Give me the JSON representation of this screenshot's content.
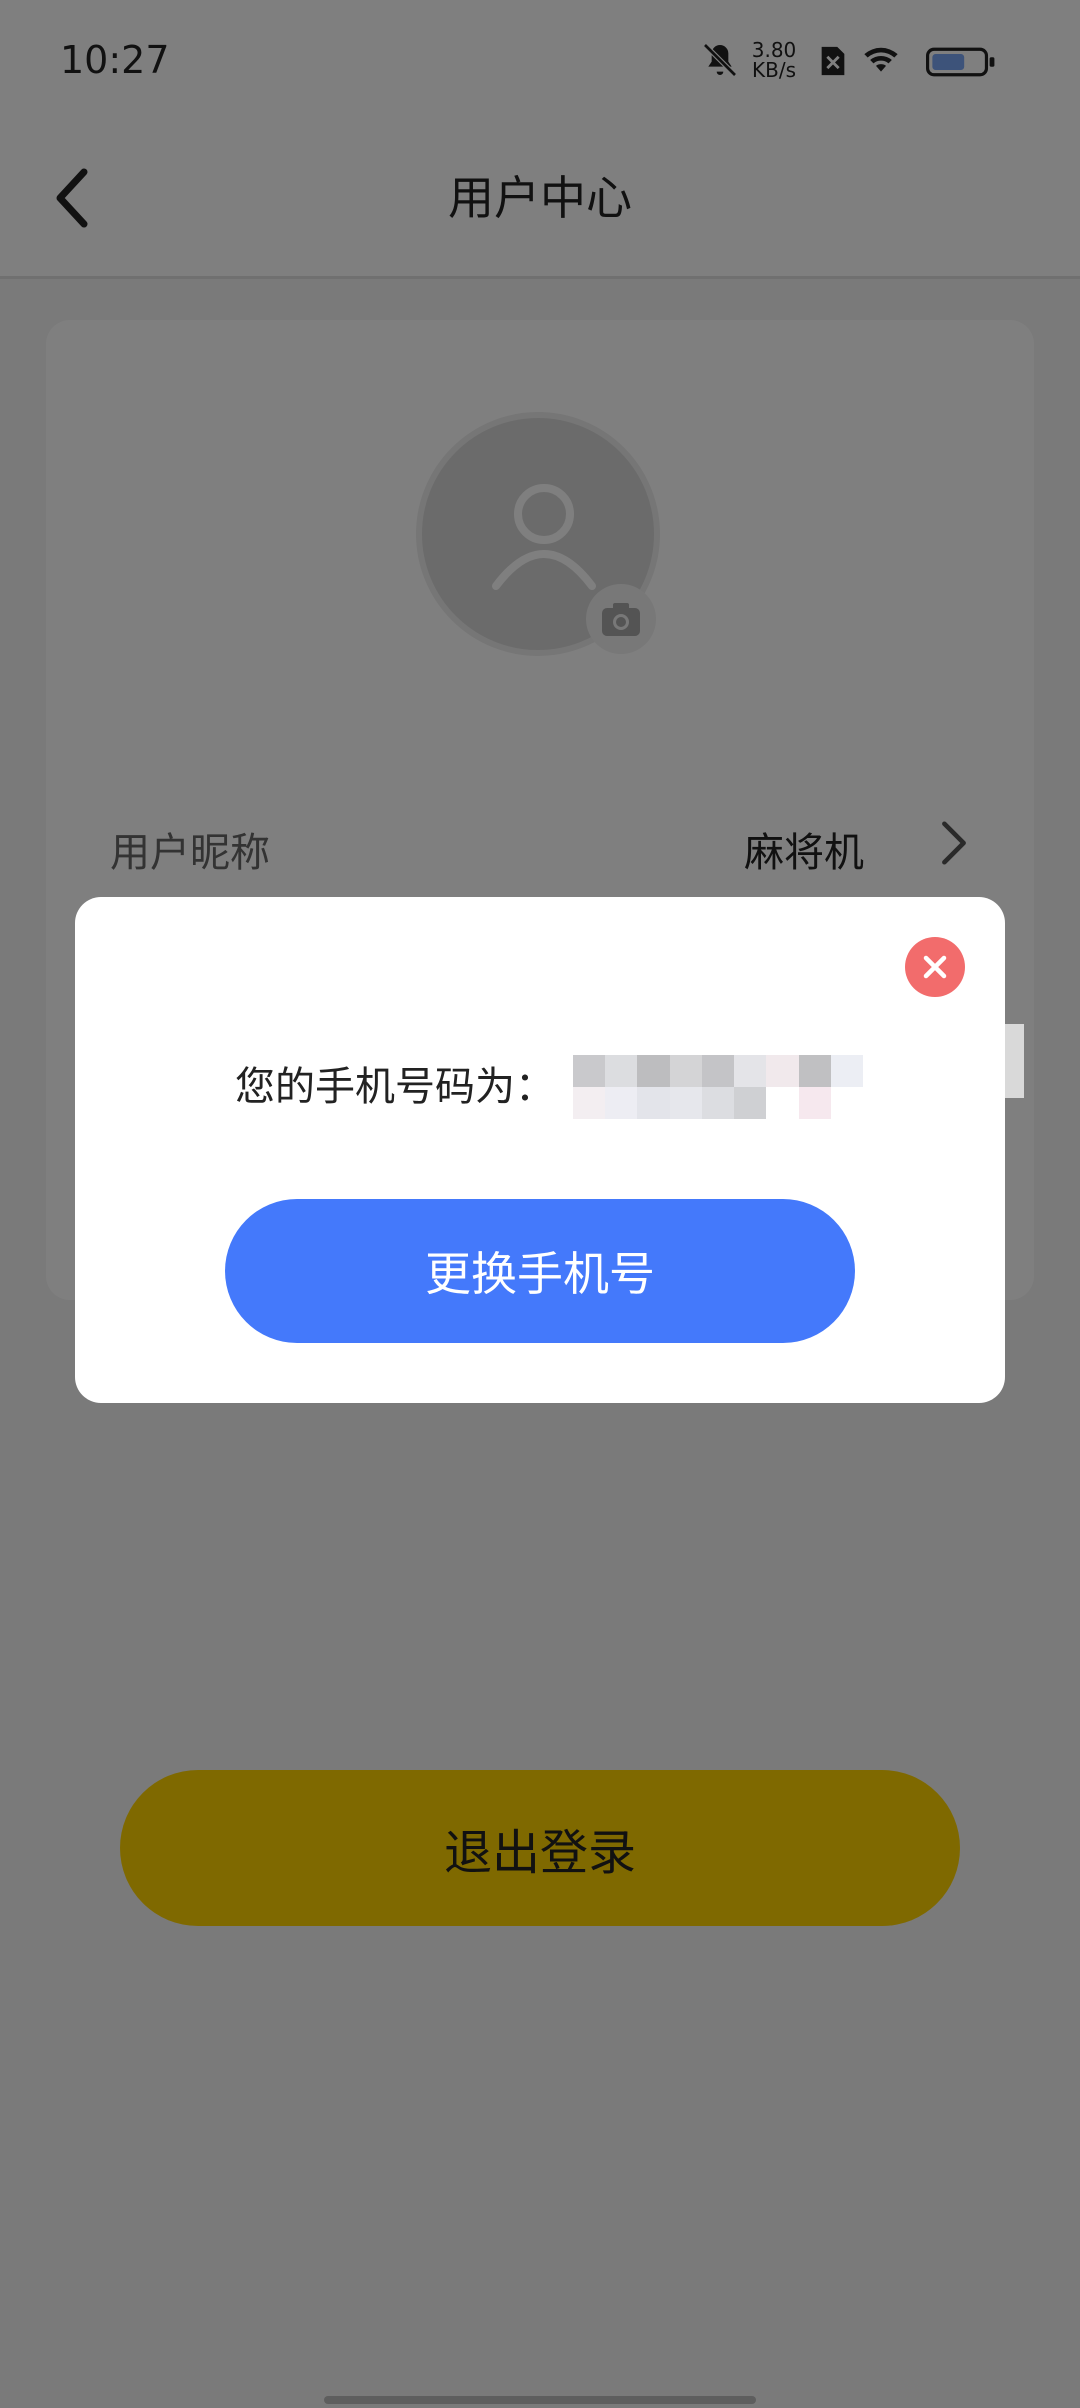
{
  "status_bar": {
    "time": "10:27",
    "net_speed_value": "3.80",
    "net_speed_unit": "KB/s",
    "icons": [
      "bell-off-icon",
      "sim-blocked-icon",
      "wifi-icon",
      "battery-icon"
    ]
  },
  "nav": {
    "back_icon": "chevron-left-icon",
    "title": "用户中心"
  },
  "profile": {
    "avatar_icon": "person-icon",
    "camera_icon": "camera-icon",
    "nickname_label": "用户昵称",
    "nickname_value": "麻将机",
    "chevron_icon": "chevron-right-icon"
  },
  "logout": {
    "label": "退出登录",
    "color": "#ffd300"
  },
  "dialog": {
    "phone_label": "您的手机号码为：",
    "change_button_label": "更换手机号",
    "close_icon": "close-icon",
    "accent": "#4479fb",
    "close_color": "#f26c6c"
  }
}
